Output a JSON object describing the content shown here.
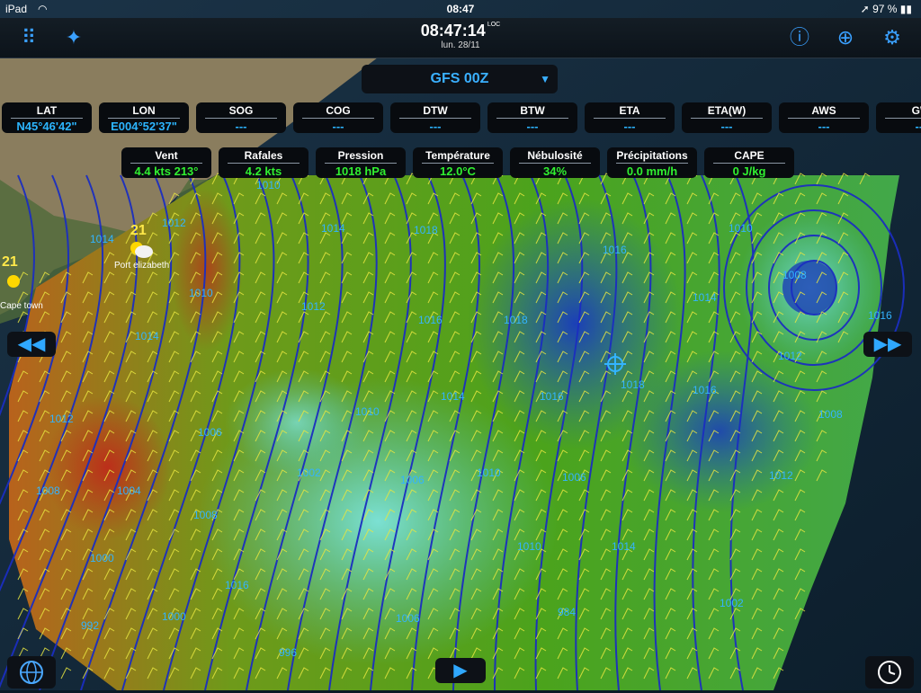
{
  "status": {
    "device": "iPad",
    "time": "08:47",
    "battery": "97 %"
  },
  "header": {
    "time": "08:47:14",
    "tz": "LOC",
    "date": "lun. 28/11"
  },
  "icons": {
    "menu": "grid-dots-icon",
    "compass": "compass-star-icon",
    "help": "help-icon",
    "target": "crosshair-icon",
    "settings": "gear-icon"
  },
  "model": {
    "label": "GFS 00Z"
  },
  "nav_row": [
    {
      "label": "LAT",
      "value": "N45°46'42\""
    },
    {
      "label": "LON",
      "value": "E004°52'37\""
    },
    {
      "label": "SOG",
      "value": "---"
    },
    {
      "label": "COG",
      "value": "---"
    },
    {
      "label": "DTW",
      "value": "---"
    },
    {
      "label": "BTW",
      "value": "---"
    },
    {
      "label": "ETA",
      "value": "---"
    },
    {
      "label": "ETA(W)",
      "value": "---"
    },
    {
      "label": "AWS",
      "value": "---"
    },
    {
      "label": "GW",
      "value": "---"
    }
  ],
  "weather_row": [
    {
      "label": "Vent",
      "value": "4.4 kts 213°"
    },
    {
      "label": "Rafales",
      "value": "4.2 kts"
    },
    {
      "label": "Pression",
      "value": "1018 hPa"
    },
    {
      "label": "Température",
      "value": "12.0°C"
    },
    {
      "label": "Nébulosité",
      "value": "34%"
    },
    {
      "label": "Précipitations",
      "value": "0.0 mm/h"
    },
    {
      "label": "CAPE",
      "value": "0 J/kg"
    }
  ],
  "map": {
    "cities": [
      {
        "name": "Port elizabeth",
        "temp": "21"
      },
      {
        "name": "Cape town",
        "temp": "21"
      }
    ],
    "isobars": [
      "1010",
      "1014",
      "1012",
      "1018",
      "1010",
      "1014",
      "1016",
      "1018",
      "1016",
      "1012",
      "1014",
      "1018",
      "1016",
      "1008",
      "1010",
      "1014",
      "1016",
      "1012",
      "1012",
      "1006",
      "1010",
      "1004",
      "1006",
      "1014",
      "1010",
      "1016",
      "1008",
      "1002",
      "1006",
      "1000",
      "1008",
      "1012",
      "1016",
      "1000",
      "992",
      "996",
      "984",
      "1002",
      "1014",
      "1010",
      "1006",
      "1008"
    ]
  },
  "controls": {
    "prev": "rewind-icon",
    "next": "fast-forward-icon",
    "play": "play-icon",
    "globe": "globe-icon",
    "clock": "clock-icon"
  }
}
